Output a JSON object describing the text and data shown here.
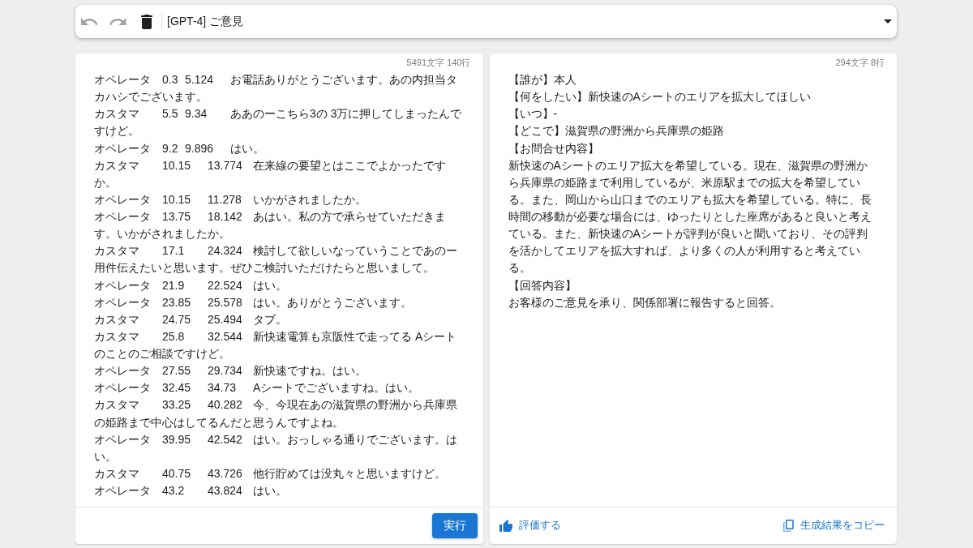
{
  "toolbar": {
    "buttons": [
      {
        "kind": "undo",
        "disabled": true
      },
      {
        "kind": "redo",
        "disabled": true
      },
      {
        "kind": "delete",
        "disabled": false
      }
    ],
    "prompt_select": {
      "value": "[GPT-4] ご意見"
    }
  },
  "input_panel": {
    "counter": "5491文字 140行",
    "lines": [
      {
        "speaker": "オペレータ",
        "start": "0.3",
        "end": "5.124",
        "text": "お電話ありがとうございます。あの内担当タカハシでございます。"
      },
      {
        "speaker": "カスタマ",
        "start": "5.5",
        "end": "9.34",
        "text": "ああのーこちら3の 3万に押してしまったんですけど。"
      },
      {
        "speaker": "オペレータ",
        "start": "9.2",
        "end": "9.896",
        "text": "はい。"
      },
      {
        "speaker": "カスタマ",
        "start": "10.15",
        "end": "13.774",
        "text": "在来線の要望とはここでよかったですか。"
      },
      {
        "speaker": "オペレータ",
        "start": "10.15",
        "end": "11.278",
        "text": "いかがされましたか。"
      },
      {
        "speaker": "オペレータ",
        "start": "13.75",
        "end": "18.142",
        "text": "あはい。私の方で承らせていただきます。いかがされましたか。"
      },
      {
        "speaker": "カスタマ",
        "start": "17.1",
        "end": "24.324",
        "text": "検討して欲しいなっていうことであのー用件伝えたいと思います。ぜひご検討いただけたらと思いまして。"
      },
      {
        "speaker": "オペレータ",
        "start": "21.9",
        "end": "22.524",
        "text": "はい。"
      },
      {
        "speaker": "オペレータ",
        "start": "23.85",
        "end": "25.578",
        "text": "はい。ありがとうございます。"
      },
      {
        "speaker": "カスタマ",
        "start": "24.75",
        "end": "25.494",
        "text": "タブ。"
      },
      {
        "speaker": "カスタマ",
        "start": "25.8",
        "end": "32.544",
        "text": "新快速電算も京阪性で走ってる Aシートのことのご相談ですけど。"
      },
      {
        "speaker": "オペレータ",
        "start": "27.55",
        "end": "29.734",
        "text": "新快速ですね。はい。"
      },
      {
        "speaker": "オペレータ",
        "start": "32.45",
        "end": "34.73",
        "text": "Aシートでございますね。はい。"
      },
      {
        "speaker": "カスタマ",
        "start": "33.25",
        "end": "40.282",
        "text": "今、今現在あの滋賀県の野洲から兵庫県の姫路まで中心はしてるんだと思うんですよね。"
      },
      {
        "speaker": "オペレータ",
        "start": "39.95",
        "end": "42.542",
        "text": "はい。おっしゃる通りでございます。はい。"
      },
      {
        "speaker": "カスタマ",
        "start": "40.75",
        "end": "43.726",
        "text": "他行貯めては没丸々と思いますけど。"
      },
      {
        "speaker": "オペレータ",
        "start": "43.2",
        "end": "43.824",
        "text": "はい。"
      }
    ],
    "run_button": "実行"
  },
  "output_panel": {
    "counter": "294文字 8行",
    "lines": [
      "【誰が】本人",
      "【何をしたい】新快速のAシートのエリアを拡大してほしい",
      "【いつ】-",
      "【どこで】滋賀県の野洲から兵庫県の姫路",
      "【お問合せ内容】",
      "新快速のAシートのエリア拡大を希望している。現在、滋賀県の野洲から兵庫県の姫路まで利用しているが、米原駅までの拡大を希望している。また、岡山から山口までのエリアも拡大を希望している。特に、長時間の移動が必要な場合には、ゆったりとした座席があると良いと考えている。また、新快速のAシートが評判が良いと聞いており、その評判を活かしてエリアを拡大すれば、より多くの人が利用すると考えている。",
      "【回答内容】",
      "お客様のご意見を承り、関係部署に報告すると回答。"
    ],
    "rate_button": "評価する",
    "copy_button": "生成結果をコピー"
  }
}
